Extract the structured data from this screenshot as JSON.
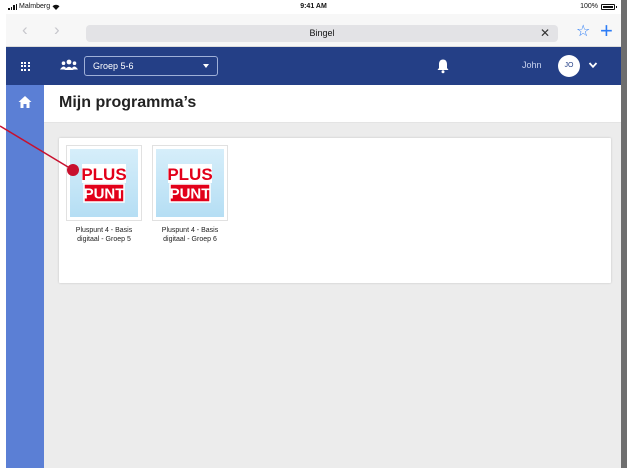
{
  "status_bar": {
    "carrier": "Malmberg",
    "time": "9:41 AM",
    "battery": "100%"
  },
  "browser": {
    "url": "Bingel",
    "icons": {
      "back": "chevron-left-icon",
      "forward": "chevron-right-icon",
      "clear": "close-icon",
      "bookmark": "star-icon",
      "new_tab": "plus-icon"
    },
    "accent_color": "#2c7cf6"
  },
  "header": {
    "group_selector": {
      "selected": "Groep 5-6"
    },
    "user": {
      "name": "John",
      "initials": "JO"
    },
    "background_color": "#243f86",
    "icons": {
      "apps": "grid-icon",
      "group": "group-icon",
      "notifications": "bell-icon",
      "user_menu": "chevron-down-icon"
    }
  },
  "sidebar": {
    "background_color": "#5b7fd5",
    "items": [
      {
        "icon": "home-icon"
      }
    ]
  },
  "main": {
    "title": "Mijn programma’s",
    "programs": [
      {
        "label": "Pluspunt 4 - Basis\ndigitaal - Groep 5",
        "logo_top": "PLUS",
        "logo_bottom": "PUNT"
      },
      {
        "label": "Pluspunt 4 - Basis\ndigitaal - Groep 6",
        "logo_top": "PLUS",
        "logo_bottom": "PUNT"
      }
    ]
  },
  "annotation": {
    "color": "#c8102e"
  }
}
